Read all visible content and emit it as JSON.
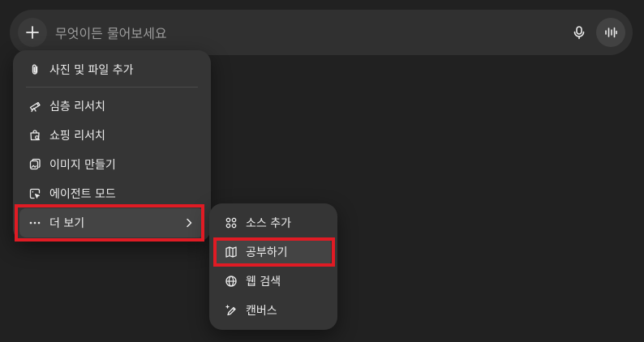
{
  "composer": {
    "placeholder": "무엇이든 물어보세요"
  },
  "menu": {
    "items": [
      {
        "label": "사진 및 파일 추가",
        "icon": "paperclip-icon"
      },
      {
        "label": "심층 리서치",
        "icon": "telescope-icon"
      },
      {
        "label": "쇼핑 리서치",
        "icon": "shopping-bag-search-icon"
      },
      {
        "label": "이미지 만들기",
        "icon": "image-create-icon"
      },
      {
        "label": "에이전트 모드",
        "icon": "agent-cursor-icon"
      },
      {
        "label": "더 보기",
        "icon": "more-dots-icon"
      }
    ]
  },
  "submenu": {
    "items": [
      {
        "label": "소스 추가",
        "icon": "sources-icon"
      },
      {
        "label": "공부하기",
        "icon": "book-open-icon"
      },
      {
        "label": "웹 검색",
        "icon": "globe-icon"
      },
      {
        "label": "캔버스",
        "icon": "pen-sparkle-icon"
      }
    ]
  },
  "colors": {
    "background": "#212121",
    "composer": "#303030",
    "menu": "#353535",
    "highlight": "#e01b24"
  }
}
